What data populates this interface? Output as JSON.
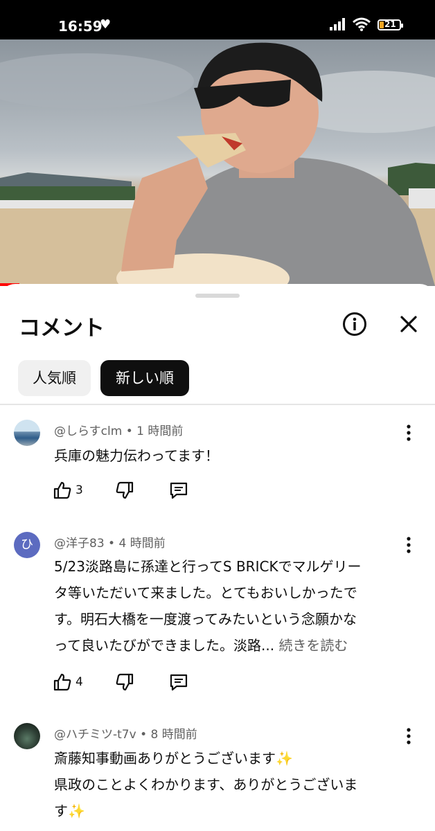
{
  "status_bar": {
    "time": "16:59",
    "battery": "21"
  },
  "comments_sheet": {
    "title": "コメント",
    "sort_chips": [
      "人気順",
      "新しい順"
    ],
    "comments": [
      {
        "author": "@しらすclm",
        "time": "1 時間前",
        "text": "兵庫の魅力伝わってます！",
        "likes": "3",
        "avatar_letter": ""
      },
      {
        "author": "@洋子83",
        "time": "4 時間前",
        "text_lines": [
          "5/23淡路島に孫達と行ってS BRICKでマルゲリー",
          "タ等いただいて来ました。とてもおいしかったで",
          "す。明石大橋を一度渡ってみたいという念願かな",
          "って良いたびができました。淡路..."
        ],
        "read_more": "続きを読む",
        "likes": "4",
        "avatar_letter": "ひ"
      },
      {
        "author": "@ハチミツ-t7v",
        "time": "8 時間前",
        "text_lines": [
          "斎藤知事動画ありがとうございます✨",
          "県政のことよくわかります、ありがとうございま",
          "す✨"
        ],
        "avatar_letter": ""
      }
    ]
  },
  "colors": {
    "accent_dark": "#0f0f0f",
    "secondary_text": "#606060",
    "progress_red": "#ff0000"
  }
}
